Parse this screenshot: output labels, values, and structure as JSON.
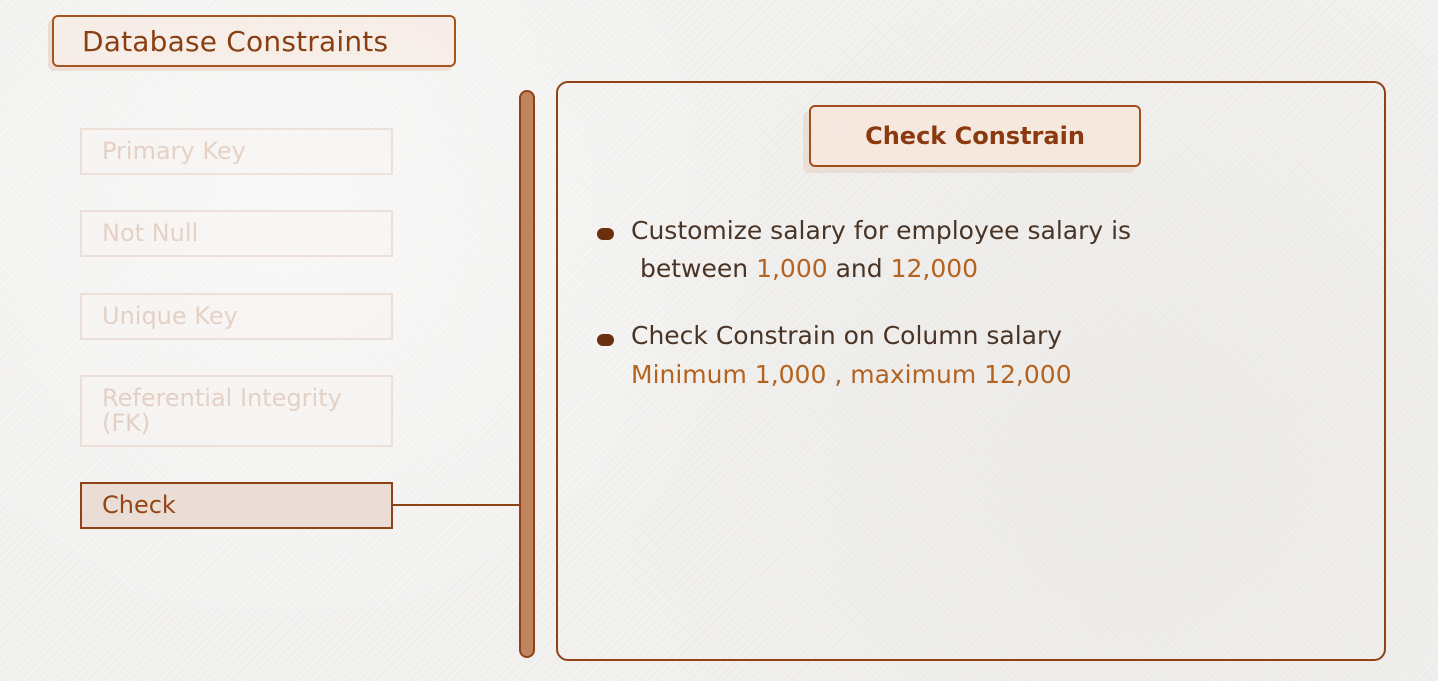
{
  "header": {
    "title": "Database Constraints"
  },
  "sidebar": {
    "items": [
      {
        "label": "Primary Key"
      },
      {
        "label": "Not Null"
      },
      {
        "label": "Unique Key"
      },
      {
        "label": "Referential Integrity (FK)",
        "line1": "Referential Integrity",
        "line2": "(FK)"
      },
      {
        "label": "Check"
      }
    ],
    "active": "Check"
  },
  "panel": {
    "title": "Check Constrain",
    "bullets": [
      {
        "line1": "Customize salary for employee salary is",
        "line2_prefix": "between ",
        "value_min": "1,000",
        "line2_mid": " and ",
        "value_max": "12,000"
      },
      {
        "line1": "Check Constrain  on Column salary",
        "line2": "Minimum 1,000 , maximum 12,000"
      }
    ]
  },
  "colors": {
    "accent": "#8e4216",
    "highlight": "#b46320",
    "text": "#4a3426",
    "inactive": "#d6b8a4"
  }
}
